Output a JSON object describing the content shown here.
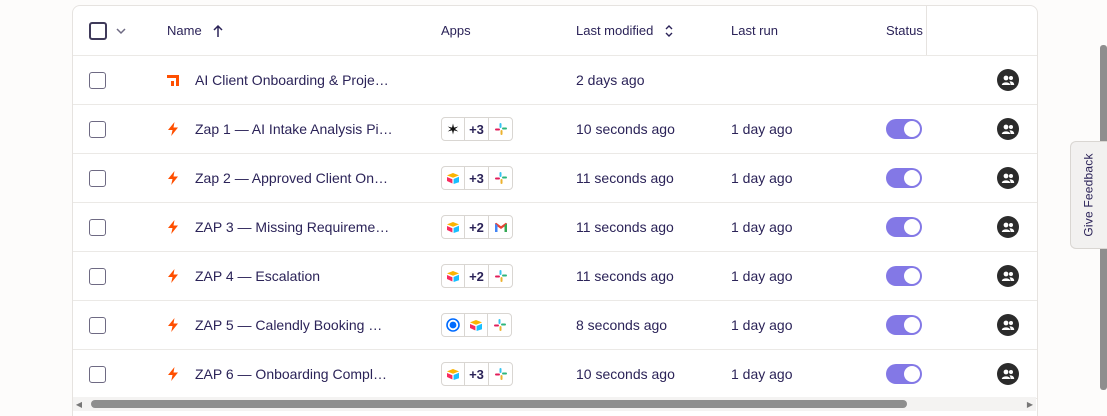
{
  "header": {
    "name": "Name",
    "apps": "Apps",
    "last_modified": "Last modified",
    "last_run": "Last run",
    "status": "Status"
  },
  "rows": [
    {
      "name": "AI Client Onboarding & Project ...",
      "type": "folder",
      "apps": null,
      "modified": "2 days ago",
      "run": "",
      "status": null
    },
    {
      "name": "Zap 1 — AI Intake Analysis Pip...",
      "type": "zap",
      "apps": [
        "star-app",
        "+3",
        "slack"
      ],
      "modified": "10 seconds ago",
      "run": "1 day ago",
      "status": "on"
    },
    {
      "name": "Zap 2 — Approved Client Onbo...",
      "type": "zap",
      "apps": [
        "airtable",
        "+3",
        "slack"
      ],
      "modified": "11 seconds ago",
      "run": "1 day ago",
      "status": "on"
    },
    {
      "name": "ZAP 3 — Missing Requirement...",
      "type": "zap",
      "apps": [
        "airtable",
        "+2",
        "gmail"
      ],
      "modified": "11 seconds ago",
      "run": "1 day ago",
      "status": "on"
    },
    {
      "name": "ZAP 4 — Escalation",
      "type": "zap",
      "apps": [
        "airtable",
        "+2",
        "slack"
      ],
      "modified": "11 seconds ago",
      "run": "1 day ago",
      "status": "on"
    },
    {
      "name": "ZAP 5 — Calendly Booking → ...",
      "type": "zap",
      "apps": [
        "calendly",
        "airtable",
        "slack"
      ],
      "modified": "8 seconds ago",
      "run": "1 day ago",
      "status": "on"
    },
    {
      "name": "ZAP 6 — Onboarding Complet...",
      "type": "zap",
      "apps": [
        "airtable",
        "+3",
        "slack"
      ],
      "modified": "10 seconds ago",
      "run": "1 day ago",
      "status": "on"
    }
  ],
  "feedback": "Give Feedback",
  "colors": {
    "accent": "#8378e6",
    "zap_orange": "#ff4f00",
    "text": "#2b2358"
  }
}
